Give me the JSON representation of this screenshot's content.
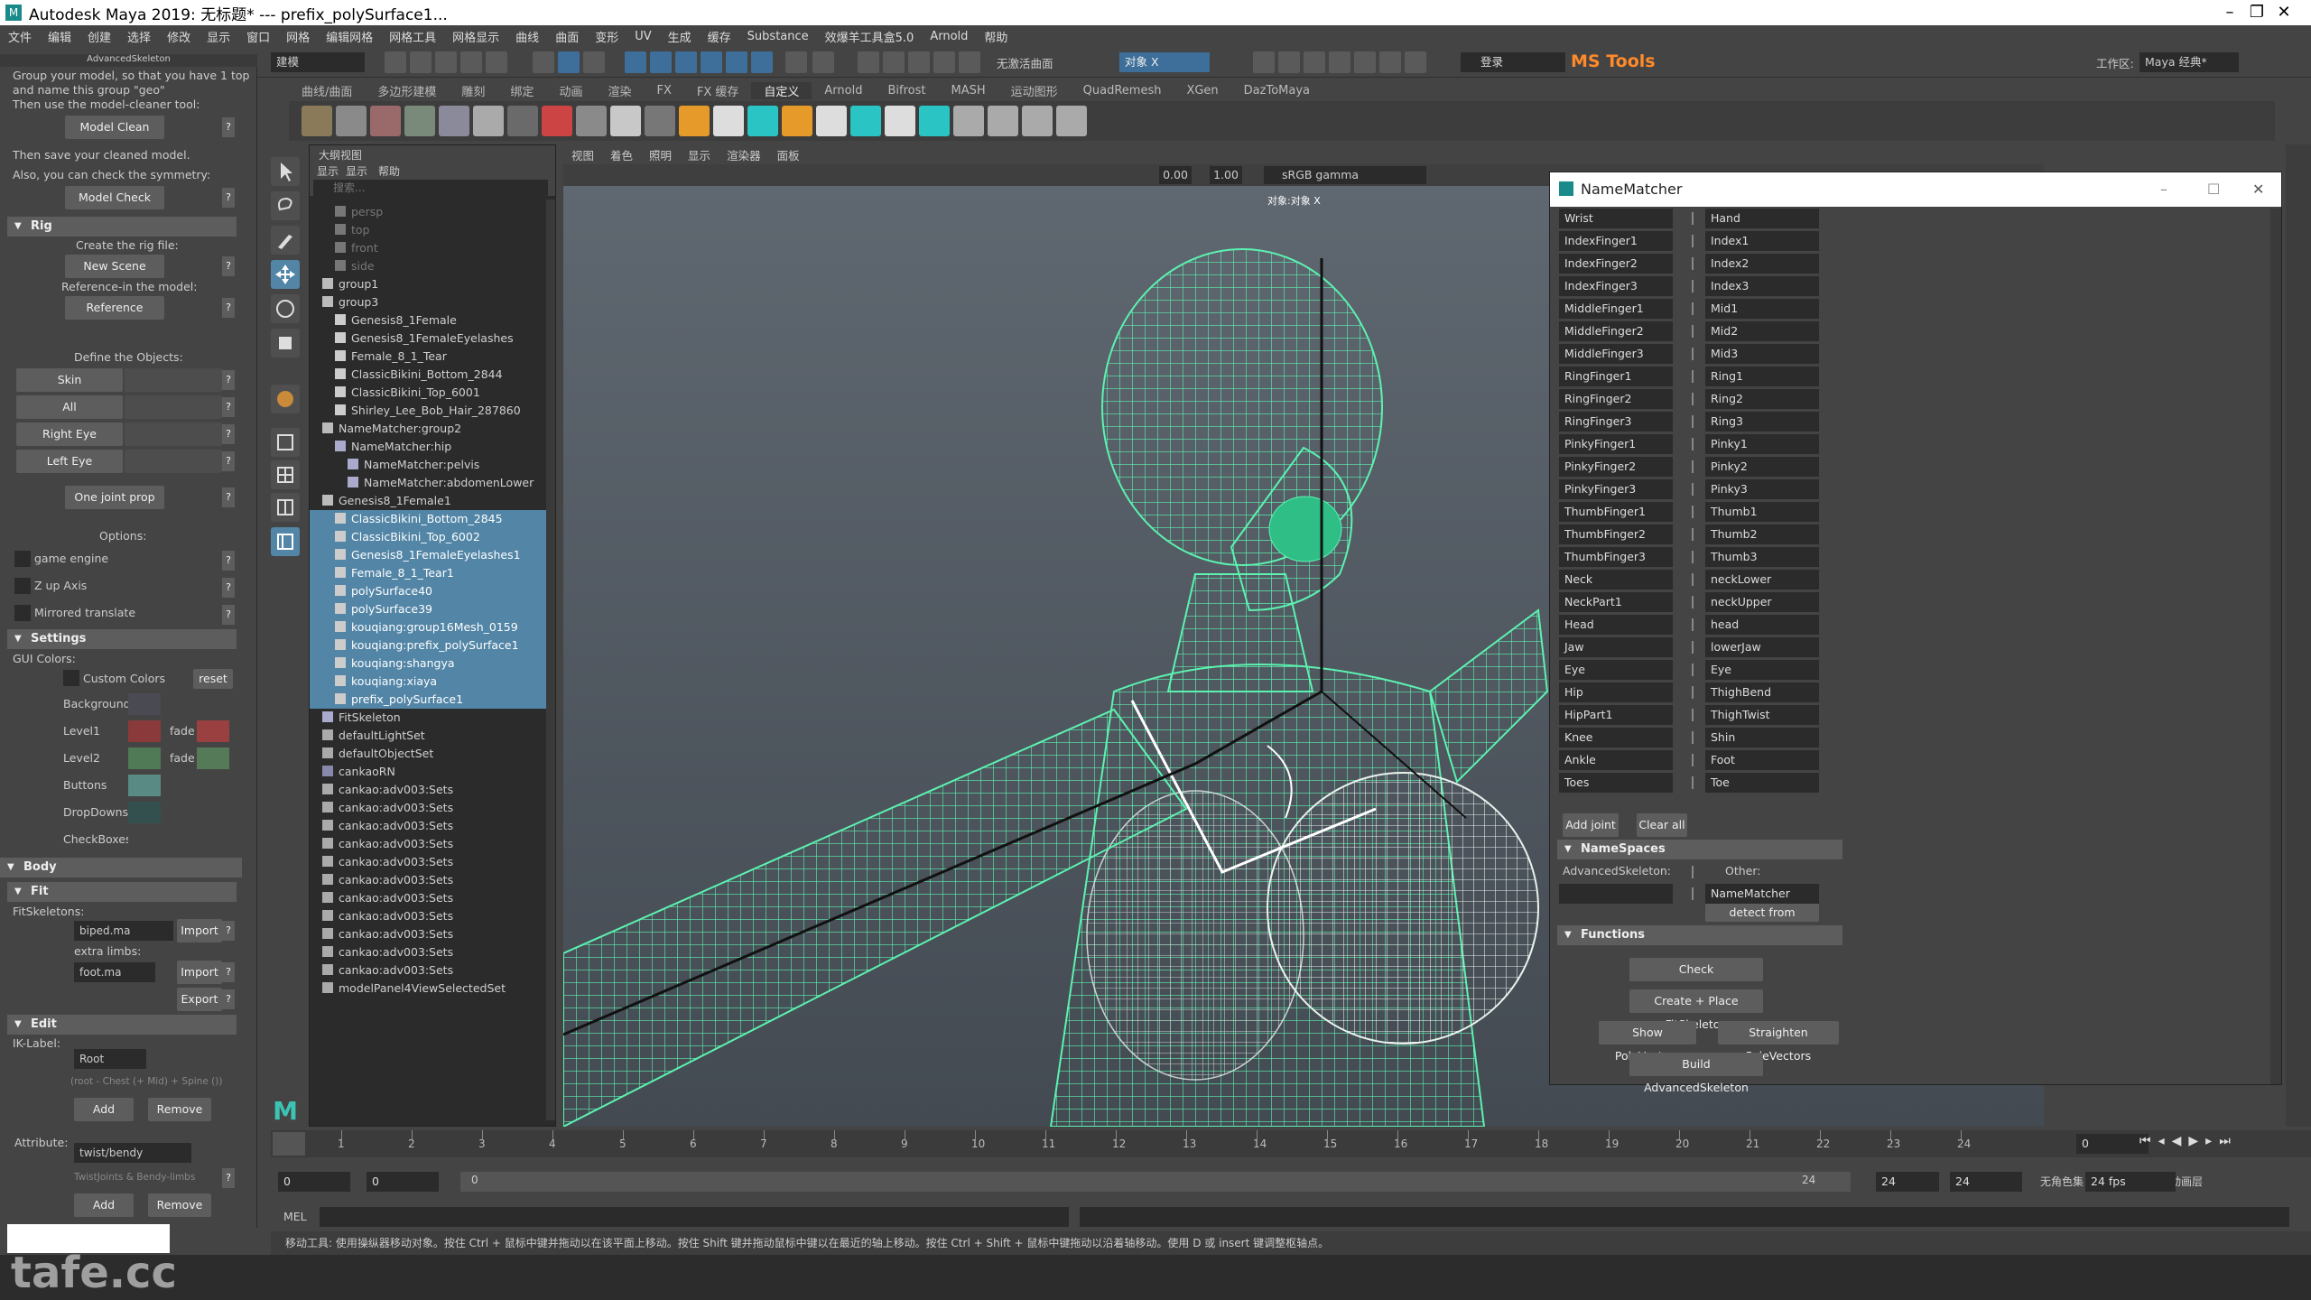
{
  "titlebar": {
    "title": "Autodesk Maya 2019: 无标题*   ---   prefix_polySurface1...",
    "minimize": "–",
    "maximize": "❐",
    "close": "✕"
  },
  "menubar": {
    "items": [
      "文件",
      "编辑",
      "创建",
      "选择",
      "修改",
      "显示",
      "窗口",
      "网格",
      "编辑网格",
      "网格工具",
      "网格显示",
      "曲线",
      "曲面",
      "变形",
      "UV",
      "生成",
      "缓存",
      "Substance",
      "效爆羊工具盒5.0",
      "Arnold",
      "帮助"
    ]
  },
  "toolbar": {
    "mode_select": "建模",
    "no_live_surface": "无激活曲面",
    "object_field": "对象 X",
    "login": "登录",
    "mstools": "MS Tools",
    "workspace_label": "工作区:",
    "workspace_value": "Maya 经典*"
  },
  "shelf": {
    "tabs": [
      "曲线/曲面",
      "多边形建模",
      "雕刻",
      "绑定",
      "动画",
      "渲染",
      "FX",
      "FX 缓存",
      "自定义",
      "Arnold",
      "Bifrost",
      "MASH",
      "运动图形",
      "QuadRemesh",
      "XGen",
      "DazToMaya"
    ],
    "active_tab": "自定义"
  },
  "leftpanel": {
    "title": "AdvancedSkeleton",
    "intro_lines": [
      "Group your model, so that you have 1 top",
      "and name this group \"geo\"",
      "Then use the model-cleaner tool:"
    ],
    "model_clean": "Model Clean",
    "save_lines": [
      "Then save your cleaned model.",
      "Also, you can check the symmetry:"
    ],
    "model_check": "Model Check",
    "rig_header": "Rig",
    "create_rig_text": "Create the rig file:",
    "new_scene": "New Scene",
    "reference_text": "Reference-in the model:",
    "reference": "Reference",
    "define_text": "Define the Objects:",
    "skin": "Skin",
    "all": "All",
    "right_eye": "Right Eye",
    "left_eye": "Left Eye",
    "one_joint_prop": "One joint prop",
    "options_text": "Options:",
    "game_engine": "game engine",
    "z_up": "Z up Axis",
    "mirrored": "Mirrored translate",
    "settings_header": "Settings",
    "gui_colors": "GUI Colors:",
    "custom_colors": "Custom Colors",
    "reset": "reset",
    "background": "Background",
    "level1": "Level1",
    "level2": "Level2",
    "fade": "fade",
    "buttons": "Buttons",
    "dropdowns": "DropDowns",
    "checkboxes": "CheckBoxes",
    "body_header": "Body",
    "fit_header": "Fit",
    "fitskeletons": "FitSkeletons:",
    "biped": "biped.ma",
    "import": "Import",
    "extra_limbs": "extra limbs:",
    "foot": "foot.ma",
    "export": "Export",
    "edit_header": "Edit",
    "iklabel": "IK-Label:",
    "root": "Root",
    "ik_hint": "(root - Chest (+ Mid) + Spine ())",
    "add": "Add",
    "remove": "Remove",
    "attribute": "Attribute:",
    "twistbendy": "twist/bendy",
    "twist_hint": "TwistJoints & Bendy-limbs",
    "add2": "Add",
    "remove2": "Remove",
    "colors": {
      "level1": "#8a3a3a",
      "level1_fade": "#9a4040",
      "level2": "#4f7a55",
      "level2_fade": "#557a58",
      "buttons": "#5a8a84",
      "dropdowns": "#34504e",
      "background": "#4a4a52"
    }
  },
  "outliner": {
    "title": "大纲视图",
    "menu": [
      "显示",
      "显示",
      "帮助"
    ],
    "search_placeholder": "搜索...",
    "rows": [
      {
        "label": "persp",
        "indent": 1,
        "dim": true,
        "sel": false,
        "icon": "camera"
      },
      {
        "label": "top",
        "indent": 1,
        "dim": true,
        "sel": false,
        "icon": "camera"
      },
      {
        "label": "front",
        "indent": 1,
        "dim": true,
        "sel": false,
        "icon": "camera"
      },
      {
        "label": "side",
        "indent": 1,
        "dim": true,
        "sel": false,
        "icon": "camera"
      },
      {
        "label": "group1",
        "indent": 0,
        "dim": false,
        "sel": false,
        "icon": "group"
      },
      {
        "label": "group3",
        "indent": 0,
        "dim": false,
        "sel": false,
        "icon": "group"
      },
      {
        "label": "Genesis8_1Female",
        "indent": 1,
        "dim": false,
        "sel": false,
        "icon": "mesh"
      },
      {
        "label": "Genesis8_1FemaleEyelashes",
        "indent": 1,
        "dim": false,
        "sel": false,
        "icon": "mesh"
      },
      {
        "label": "Female_8_1_Tear",
        "indent": 1,
        "dim": false,
        "sel": false,
        "icon": "mesh"
      },
      {
        "label": "ClassicBikini_Bottom_2844",
        "indent": 1,
        "dim": false,
        "sel": false,
        "icon": "mesh"
      },
      {
        "label": "ClassicBikini_Top_6001",
        "indent": 1,
        "dim": false,
        "sel": false,
        "icon": "mesh"
      },
      {
        "label": "Shirley_Lee_Bob_Hair_287860",
        "indent": 1,
        "dim": false,
        "sel": false,
        "icon": "mesh"
      },
      {
        "label": "NameMatcher:group2",
        "indent": 0,
        "dim": false,
        "sel": false,
        "icon": "group"
      },
      {
        "label": "NameMatcher:hip",
        "indent": 1,
        "dim": false,
        "sel": false,
        "icon": "joint"
      },
      {
        "label": "NameMatcher:pelvis",
        "indent": 2,
        "dim": false,
        "sel": false,
        "icon": "joint"
      },
      {
        "label": "NameMatcher:abdomenLower",
        "indent": 2,
        "dim": false,
        "sel": false,
        "icon": "joint"
      },
      {
        "label": "Genesis8_1Female1",
        "indent": 0,
        "dim": false,
        "sel": false,
        "icon": "group"
      },
      {
        "label": "ClassicBikini_Bottom_2845",
        "indent": 1,
        "dim": false,
        "sel": true,
        "icon": "mesh"
      },
      {
        "label": "ClassicBikini_Top_6002",
        "indent": 1,
        "dim": false,
        "sel": true,
        "icon": "mesh"
      },
      {
        "label": "Genesis8_1FemaleEyelashes1",
        "indent": 1,
        "dim": false,
        "sel": true,
        "icon": "mesh"
      },
      {
        "label": "Female_8_1_Tear1",
        "indent": 1,
        "dim": false,
        "sel": true,
        "icon": "mesh"
      },
      {
        "label": "polySurface40",
        "indent": 1,
        "dim": false,
        "sel": true,
        "icon": "mesh"
      },
      {
        "label": "polySurface39",
        "indent": 1,
        "dim": false,
        "sel": true,
        "icon": "mesh"
      },
      {
        "label": "kouqiang:group16Mesh_0159",
        "indent": 1,
        "dim": false,
        "sel": true,
        "icon": "mesh"
      },
      {
        "label": "kouqiang:prefix_polySurface1",
        "indent": 1,
        "dim": false,
        "sel": true,
        "icon": "mesh"
      },
      {
        "label": "kouqiang:shangya",
        "indent": 1,
        "dim": false,
        "sel": true,
        "icon": "mesh"
      },
      {
        "label": "kouqiang:xiaya",
        "indent": 1,
        "dim": false,
        "sel": true,
        "icon": "mesh"
      },
      {
        "label": "prefix_polySurface1",
        "indent": 1,
        "dim": false,
        "sel": true,
        "icon": "mesh"
      },
      {
        "label": "FitSkeleton",
        "indent": 0,
        "dim": false,
        "sel": false,
        "icon": "joint"
      },
      {
        "label": "defaultLightSet",
        "indent": 0,
        "dim": false,
        "sel": false,
        "icon": "set"
      },
      {
        "label": "defaultObjectSet",
        "indent": 0,
        "dim": false,
        "sel": false,
        "icon": "set"
      },
      {
        "label": "cankaoRN",
        "indent": 0,
        "dim": false,
        "sel": false,
        "icon": "ref"
      },
      {
        "label": "cankao:adv003:Sets",
        "indent": 0,
        "dim": false,
        "sel": false,
        "icon": "set"
      },
      {
        "label": "cankao:adv003:Sets",
        "indent": 0,
        "dim": false,
        "sel": false,
        "icon": "set"
      },
      {
        "label": "cankao:adv003:Sets",
        "indent": 0,
        "dim": false,
        "sel": false,
        "icon": "set"
      },
      {
        "label": "cankao:adv003:Sets",
        "indent": 0,
        "dim": false,
        "sel": false,
        "icon": "set"
      },
      {
        "label": "cankao:adv003:Sets",
        "indent": 0,
        "dim": false,
        "sel": false,
        "icon": "set"
      },
      {
        "label": "cankao:adv003:Sets",
        "indent": 0,
        "dim": false,
        "sel": false,
        "icon": "set"
      },
      {
        "label": "cankao:adv003:Sets",
        "indent": 0,
        "dim": false,
        "sel": false,
        "icon": "set"
      },
      {
        "label": "cankao:adv003:Sets",
        "indent": 0,
        "dim": false,
        "sel": false,
        "icon": "set"
      },
      {
        "label": "cankao:adv003:Sets",
        "indent": 0,
        "dim": false,
        "sel": false,
        "icon": "set"
      },
      {
        "label": "cankao:adv003:Sets",
        "indent": 0,
        "dim": false,
        "sel": false,
        "icon": "set"
      },
      {
        "label": "cankao:adv003:Sets",
        "indent": 0,
        "dim": false,
        "sel": false,
        "icon": "set"
      },
      {
        "label": "modelPanel4ViewSelectedSet",
        "indent": 0,
        "dim": false,
        "sel": false,
        "icon": "set"
      }
    ]
  },
  "viewport": {
    "menu": [
      "视图",
      "着色",
      "照明",
      "显示",
      "渲染器",
      "面板"
    ],
    "exposure": "0.00",
    "gamma": "1.00",
    "colorspace": "sRGB gamma",
    "camera_label": "对象:对象 X"
  },
  "namematcher": {
    "title": "NameMatcher",
    "rows": [
      [
        "Wrist",
        "Hand"
      ],
      [
        "IndexFinger1",
        "Index1"
      ],
      [
        "IndexFinger2",
        "Index2"
      ],
      [
        "IndexFinger3",
        "Index3"
      ],
      [
        "MiddleFinger1",
        "Mid1"
      ],
      [
        "MiddleFinger2",
        "Mid2"
      ],
      [
        "MiddleFinger3",
        "Mid3"
      ],
      [
        "RingFinger1",
        "Ring1"
      ],
      [
        "RingFinger2",
        "Ring2"
      ],
      [
        "RingFinger3",
        "Ring3"
      ],
      [
        "PinkyFinger1",
        "Pinky1"
      ],
      [
        "PinkyFinger2",
        "Pinky2"
      ],
      [
        "PinkyFinger3",
        "Pinky3"
      ],
      [
        "ThumbFinger1",
        "Thumb1"
      ],
      [
        "ThumbFinger2",
        "Thumb2"
      ],
      [
        "ThumbFinger3",
        "Thumb3"
      ],
      [
        "Neck",
        "neckLower"
      ],
      [
        "NeckPart1",
        "neckUpper"
      ],
      [
        "Head",
        "head"
      ],
      [
        "Jaw",
        "lowerJaw"
      ],
      [
        "Eye",
        "Eye"
      ],
      [
        "Hip",
        "ThighBend"
      ],
      [
        "HipPart1",
        "ThighTwist"
      ],
      [
        "Knee",
        "Shin"
      ],
      [
        "Ankle",
        "Foot"
      ],
      [
        "Toes",
        "Toe"
      ]
    ],
    "add_joint": "Add joint",
    "clear_all": "Clear all",
    "namespaces_header": "NameSpaces",
    "advskel_label": "AdvancedSkeleton:",
    "other_label": "Other:",
    "other_value": "NameMatcher",
    "detect": "detect from selected",
    "functions_header": "Functions",
    "check": "Check",
    "create_place": "Create + Place FitSkeleton",
    "show_pole": "Show PoleVectors",
    "straighten_pole": "Straighten PoleVectors",
    "build": "Build AdvancedSkeleton"
  },
  "timeline": {
    "ticks": [
      "1",
      "2",
      "3",
      "4",
      "5",
      "6",
      "7",
      "8",
      "9",
      "10",
      "11",
      "12",
      "13",
      "14",
      "15",
      "16",
      "17",
      "18",
      "19",
      "20",
      "21",
      "22",
      "23",
      "24"
    ],
    "current_frame_left": "0",
    "current_frame": "0",
    "range_start": "0",
    "range_start2": "0",
    "slider_start": "0",
    "slider_end": "24",
    "range_end": "24",
    "range_end2": "24",
    "character_set": "无角色集",
    "anim_layer": "无动画层",
    "fps": "24 fps"
  },
  "mel": {
    "label": "MEL"
  },
  "helpline": "移动工具: 使用操纵器移动对象。按住 Ctrl + 鼠标中键并拖动以在该平面上移动。按住 Shift 键并拖动鼠标中键以在最近的轴上移动。按住 Ctrl + Shift + 鼠标中键拖动以沿着轴移动。使用 D 或 insert 键调整枢轴点。",
  "watermark": "tafe.cc",
  "colors": {
    "selection": "#5285a6",
    "wire_green": "#5cf2b0",
    "wire_white": "#e8f2ec"
  }
}
